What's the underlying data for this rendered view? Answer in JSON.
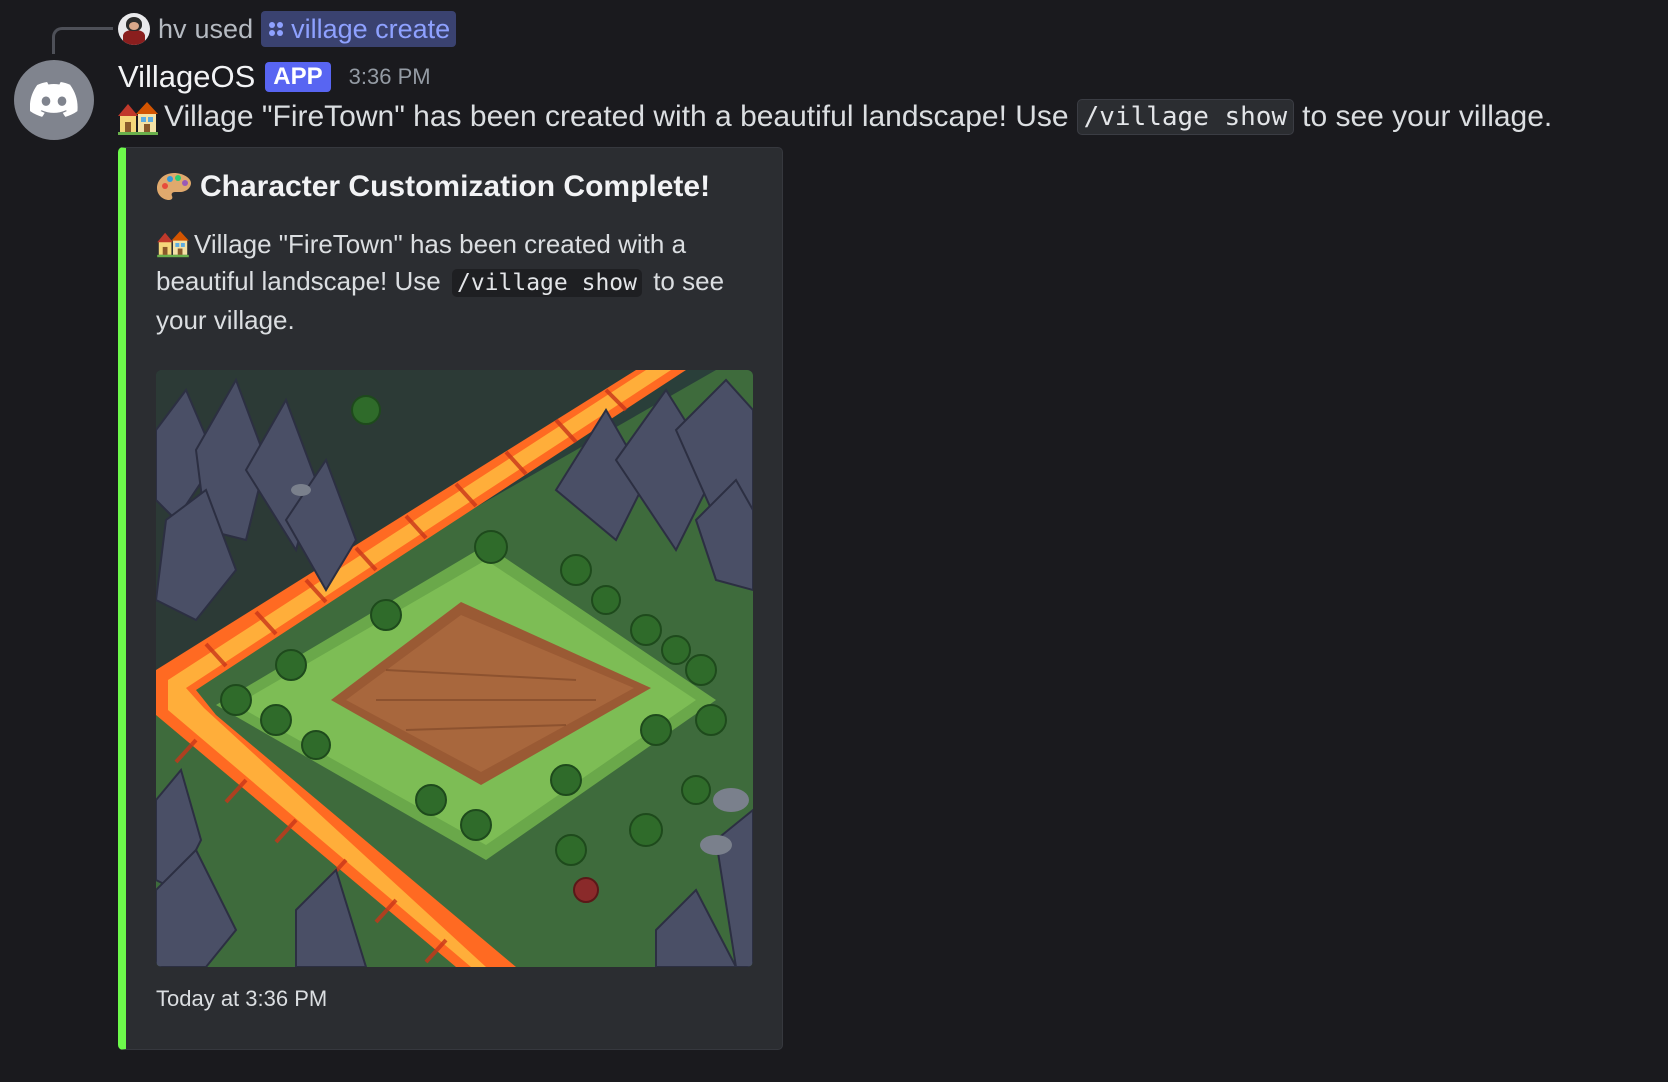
{
  "reply": {
    "user": "hv",
    "action": "used",
    "command": "village create"
  },
  "message": {
    "author": "VillageOS",
    "badge": "APP",
    "time": "3:36 PM",
    "text_before": "Village \"FireTown\" has been created with a beautiful landscape! Use",
    "code": "/village show",
    "text_after": "to see your village."
  },
  "embed": {
    "accent_color": "#6dfa4b",
    "title": "Character Customization Complete!",
    "desc_before": "Village \"FireTown\" has been created with a beautiful landscape! Use",
    "desc_code": "/village show",
    "desc_after": "to see your village.",
    "footer": "Today at 3:36 PM"
  },
  "icons": {
    "bot_avatar": "discord-logo-icon",
    "houses_emoji": "houses-icon",
    "palette_emoji": "palette-icon",
    "command_icon": "app-command-icon"
  }
}
